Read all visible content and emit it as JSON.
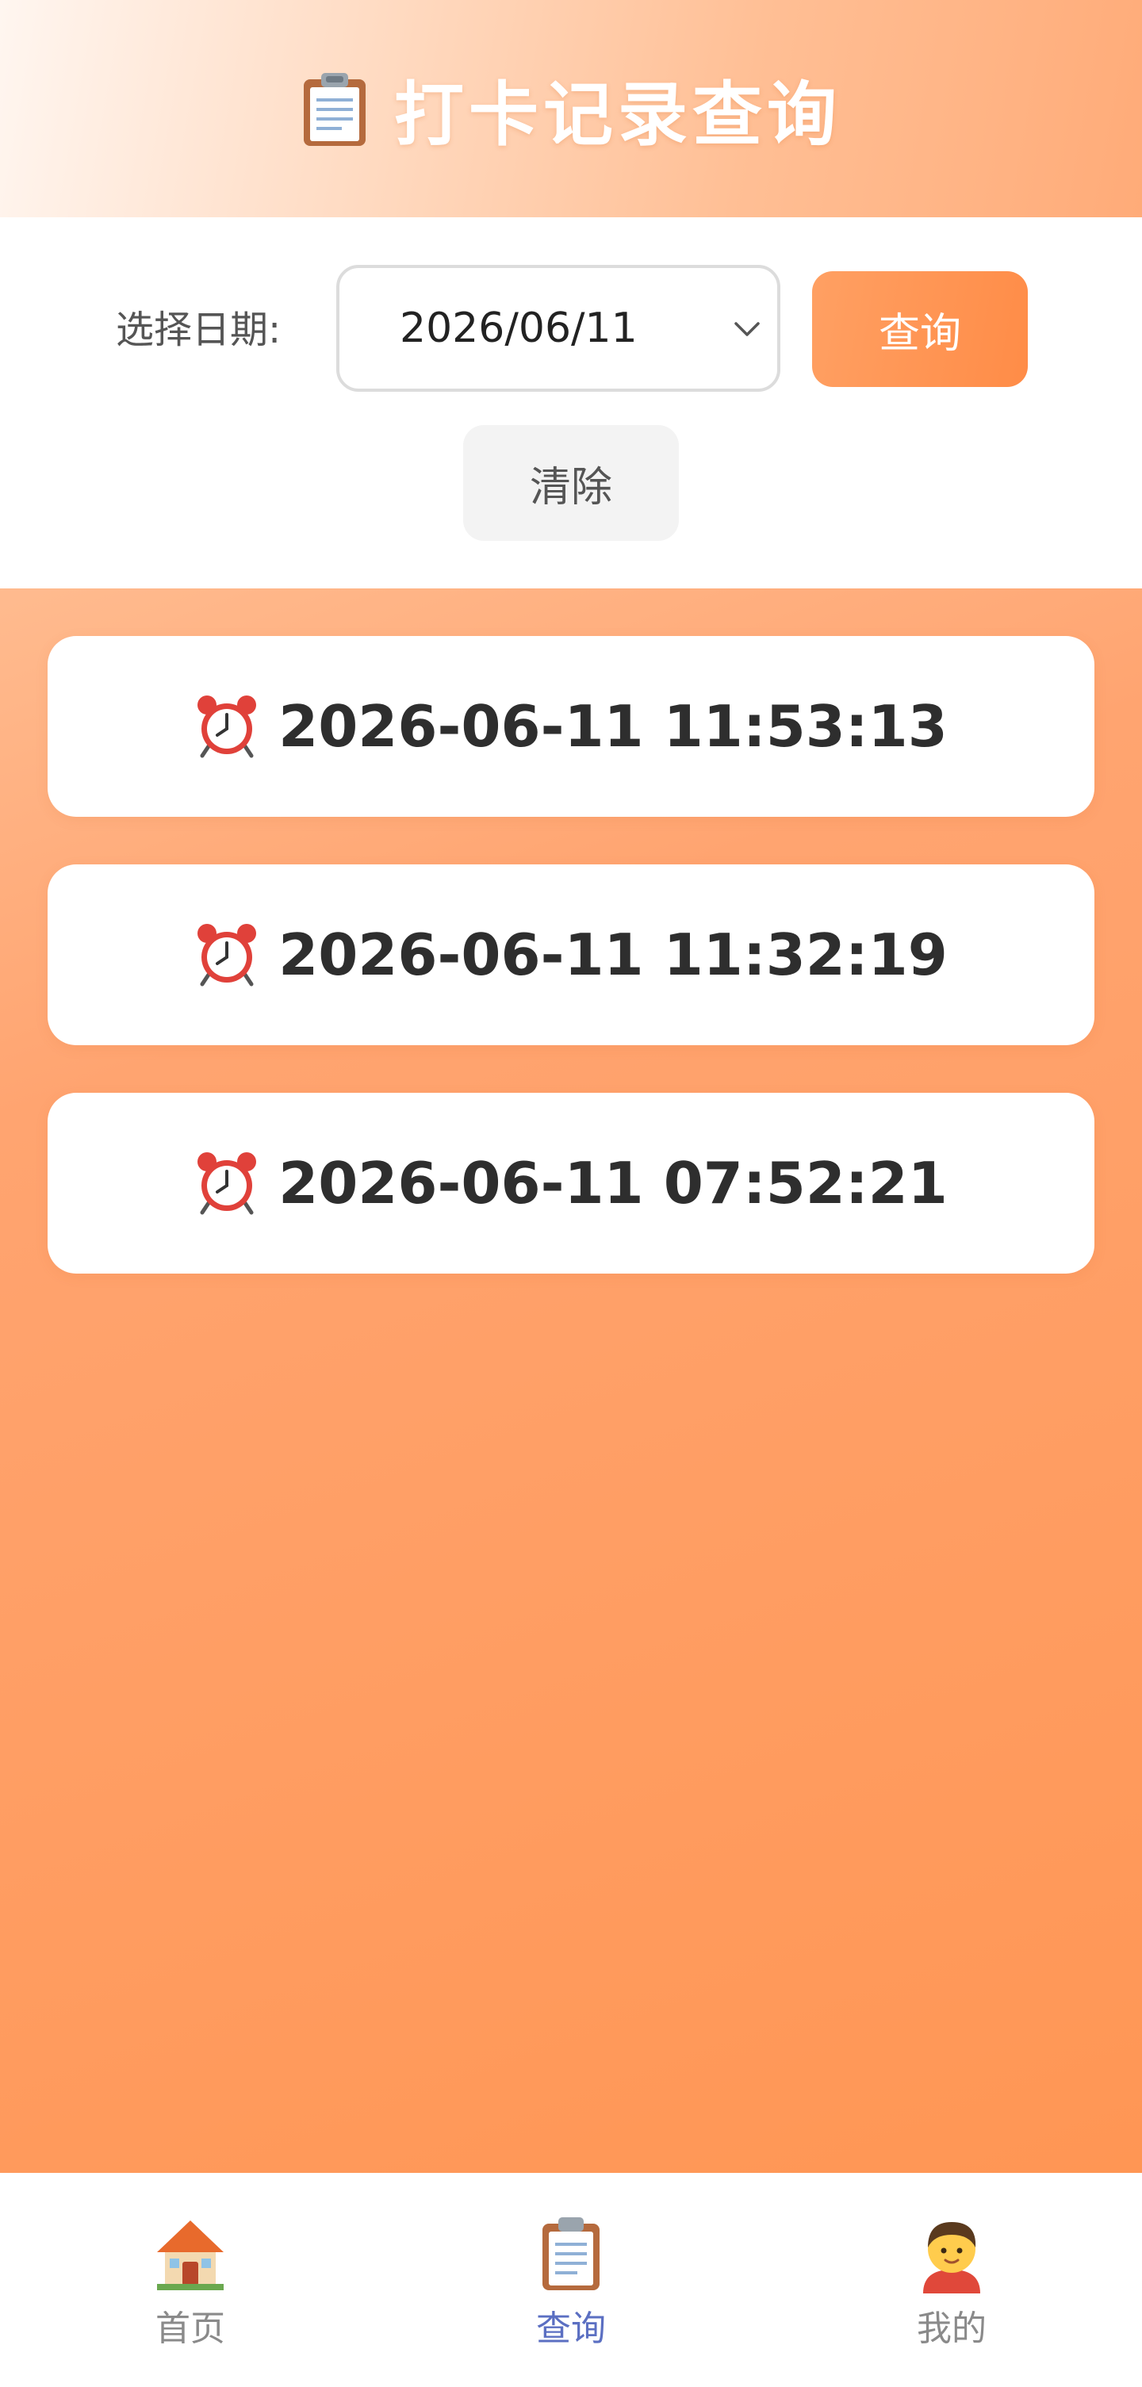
{
  "header": {
    "title": "打卡记录查询",
    "icon": "clipboard-icon"
  },
  "filter": {
    "date_label": "选择日期:",
    "date_value": "2026/06/11",
    "query_label": "查询",
    "clear_label": "清除"
  },
  "records": [
    {
      "icon": "alarm-clock-icon",
      "time": "2026-06-11 11:53:13"
    },
    {
      "icon": "alarm-clock-icon",
      "time": "2026-06-11 11:32:19"
    },
    {
      "icon": "alarm-clock-icon",
      "time": "2026-06-11 07:52:21"
    }
  ],
  "nav": {
    "items": [
      {
        "label": "首页",
        "icon": "house-icon",
        "active": false
      },
      {
        "label": "查询",
        "icon": "clipboard-icon",
        "active": true
      },
      {
        "label": "我的",
        "icon": "person-icon",
        "active": false
      }
    ]
  },
  "colors": {
    "accent": "#ff8c47",
    "active_nav": "#5b6fc2",
    "header_gradient_end": "#ffab78"
  }
}
